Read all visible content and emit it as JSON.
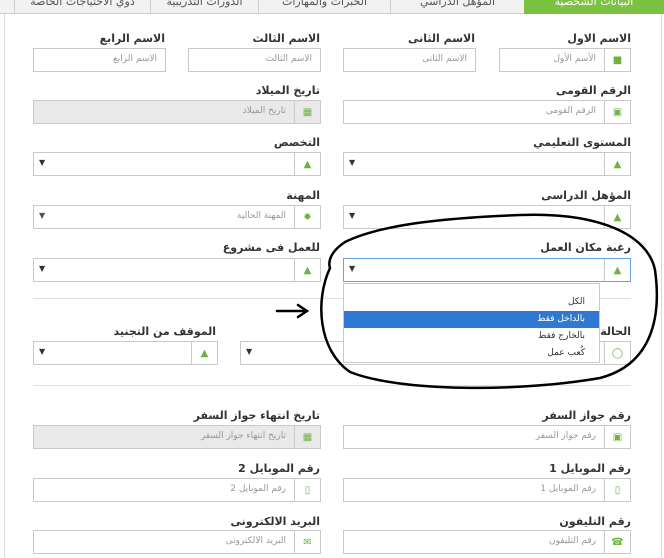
{
  "tabs": [
    {
      "label": "البيانات الشخصية",
      "active": true
    },
    {
      "label": "المؤهل الدراسي",
      "active": false
    },
    {
      "label": "الخبرات والمهارات",
      "active": false
    },
    {
      "label": "الدورات التدريبية",
      "active": false
    },
    {
      "label": "ذوي الاحتياجات الخاصة",
      "active": false
    }
  ],
  "labels": {
    "first_name": "الاسم الاول",
    "second_name": "الاسم الثانى",
    "third_name": "الاسم الثالث",
    "fourth_name": "الاسم الرابع",
    "national_id": "الرقم القومى",
    "birth_date": "تاريخ الميلاد",
    "education_level": "المستوى التعليمي",
    "specialization": "التخصص",
    "qualification": "المؤهل الدراسى",
    "profession": "المهنة",
    "work_place_preference": "رغبة مكان العمل",
    "project_work_preference": "للعمل فى مشروع",
    "marital_status": "الحالة ا",
    "military_status": "الموقف من التجنيد",
    "passport_number": "رقم جواز السفر",
    "passport_expiry": "تاريخ انتهاء جواز السفر",
    "mobile1": "رقم الموبايل 1",
    "mobile2": "رقم الموبايل 2",
    "phone": "رقم التليفون",
    "email": "البريد الالكترونى"
  },
  "placeholders": {
    "first_name": "الأسم الأول",
    "second_name": "الاسم الثانى",
    "third_name": "الاسم الثالث",
    "fourth_name": "الاسم الرابع",
    "national_id": "الرقم القومى",
    "birth_date": "تاريخ الميلاد",
    "profession": "المهنة الحالية",
    "passport_number": "رقم جواز السفر",
    "passport_expiry": "تاريخ انتهاء جواز السفر",
    "mobile1": "رقم الموبايل 1",
    "mobile2": "رقم الموبايل 2",
    "phone": "رقم التليفون",
    "email": "البريد الالكترونى"
  },
  "work_place_options": [
    {
      "label": "الكل",
      "selected": false
    },
    {
      "label": "بالداخل فقط",
      "selected": true
    },
    {
      "label": "بالخارج فقط",
      "selected": false
    },
    {
      "label": "كُعب عمل",
      "selected": false
    }
  ],
  "colors": {
    "accent": "#7cc242",
    "icon": "#6db33f",
    "selected": "#2f7ad0"
  }
}
